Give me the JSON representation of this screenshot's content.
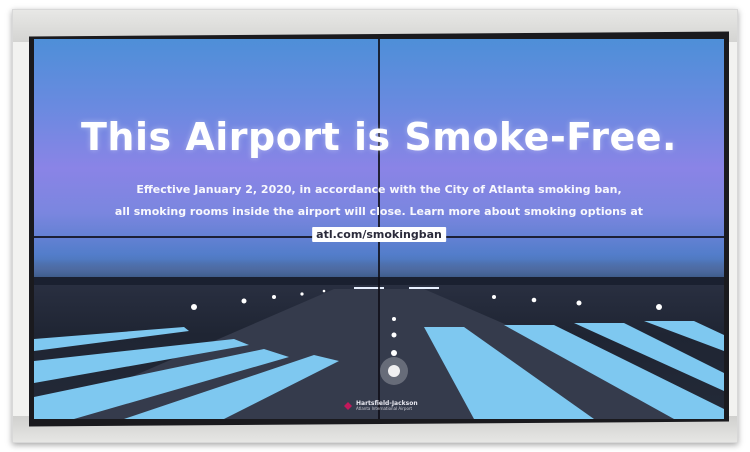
{
  "sign": {
    "headline": "This Airport is Smoke-Free.",
    "line1": "Effective January 2, 2020, in accordance with the City of Atlanta smoking ban,",
    "line2": "all smoking rooms inside the airport will close. Learn more about smoking options at",
    "url": "atl.com/smokingban"
  },
  "logo": {
    "name": "Hartsfield-Jackson",
    "subtitle": "Atlanta International Airport",
    "accent_color": "#c2185b"
  },
  "colors": {
    "sky_top": "#4e8fd8",
    "sky_mid": "#8a84e6",
    "runway_markings": "#7ec8f0"
  }
}
